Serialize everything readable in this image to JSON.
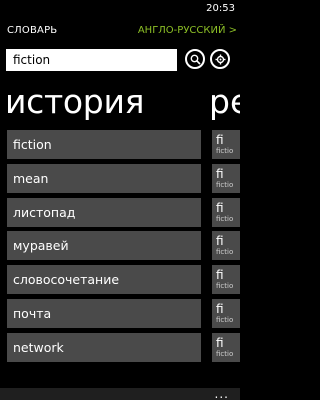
{
  "status": {
    "time": "20:53"
  },
  "header": {
    "title": "СЛОВАРЬ",
    "dictionary": "АНГЛО-РУССКИЙ >"
  },
  "search": {
    "value": "fiction"
  },
  "pivot": {
    "current": "история",
    "next": "ре"
  },
  "history": {
    "items": [
      {
        "label": "fiction"
      },
      {
        "label": "mean"
      },
      {
        "label": "листопад"
      },
      {
        "label": "муравей"
      },
      {
        "label": "словосочетание"
      },
      {
        "label": "почта"
      },
      {
        "label": "network"
      }
    ]
  },
  "peek": {
    "items": [
      {
        "title": "fi",
        "sub": "fictio"
      },
      {
        "title": "fi",
        "sub": "fictio"
      },
      {
        "title": "fi",
        "sub": "fictio"
      },
      {
        "title": "fi",
        "sub": "fictio"
      },
      {
        "title": "fi",
        "sub": "fictio"
      },
      {
        "title": "fi",
        "sub": "fictio"
      },
      {
        "title": "fi",
        "sub": "fictio"
      }
    ]
  },
  "appbar": {
    "more": "..."
  },
  "icons": {
    "search": "search-icon",
    "settings": "settings-icon"
  },
  "colors": {
    "accent": "#8cbf26",
    "tile": "#4a4a4a",
    "background": "#000000"
  }
}
